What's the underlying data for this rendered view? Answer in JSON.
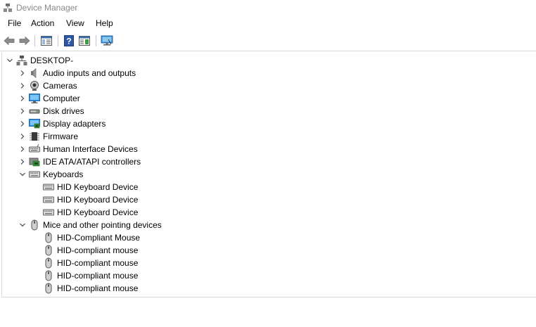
{
  "window": {
    "title": "Device Manager"
  },
  "menu": [
    "File",
    "Action",
    "View",
    "Help"
  ],
  "toolbar": [
    "back-icon",
    "forward-icon",
    "show-hide-console-tree-icon",
    "help-icon",
    "action-pane-icon",
    "monitor-icon"
  ],
  "tree": {
    "root": "DESKTOP-",
    "categories": [
      {
        "label": "Audio inputs and outputs",
        "icon": "speaker-icon",
        "expanded": false
      },
      {
        "label": "Cameras",
        "icon": "camera-icon",
        "expanded": false
      },
      {
        "label": "Computer",
        "icon": "computer-icon",
        "expanded": false
      },
      {
        "label": "Disk drives",
        "icon": "disk-drive-icon",
        "expanded": false
      },
      {
        "label": "Display adapters",
        "icon": "display-adapter-icon",
        "expanded": false
      },
      {
        "label": "Firmware",
        "icon": "chip-icon",
        "expanded": false
      },
      {
        "label": "Human Interface Devices",
        "icon": "hid-icon",
        "expanded": false
      },
      {
        "label": "IDE ATA/ATAPI controllers",
        "icon": "ide-controller-icon",
        "expanded": false
      },
      {
        "label": "Keyboards",
        "icon": "keyboard-icon",
        "expanded": true,
        "children": [
          "HID Keyboard Device",
          "HID Keyboard Device",
          "HID Keyboard Device"
        ]
      },
      {
        "label": "Mice and other pointing devices",
        "icon": "mouse-icon",
        "expanded": true,
        "children": [
          "HID-Compliant Mouse",
          "HID-compliant mouse",
          "HID-compliant mouse",
          "HID-compliant mouse",
          "HID-compliant mouse"
        ]
      }
    ]
  }
}
